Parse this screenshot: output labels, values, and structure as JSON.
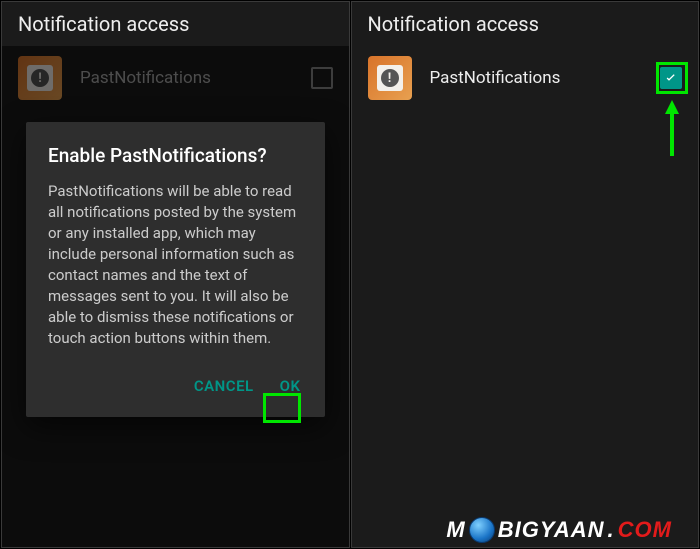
{
  "left": {
    "header": "Notification access",
    "app": {
      "name": "PastNotifications",
      "checked": false
    },
    "dialog": {
      "title": "Enable PastNotifications?",
      "body": "PastNotifications will be able to read all notifications posted by the system or any installed app, which may include personal information such as contact names and the text of messages sent to you. It will also be able to dismiss these notifications or touch action buttons within them.",
      "cancel": "CANCEL",
      "ok": "OK"
    }
  },
  "right": {
    "header": "Notification access",
    "app": {
      "name": "PastNotifications",
      "checked": true
    }
  },
  "watermark": {
    "pre": "M",
    "post": "BIGYAAN",
    "dot": ".",
    "tld": "COM"
  },
  "annotations": {
    "highlight_ok": true,
    "highlight_checkbox": true,
    "arrow_to_checkbox": true
  }
}
